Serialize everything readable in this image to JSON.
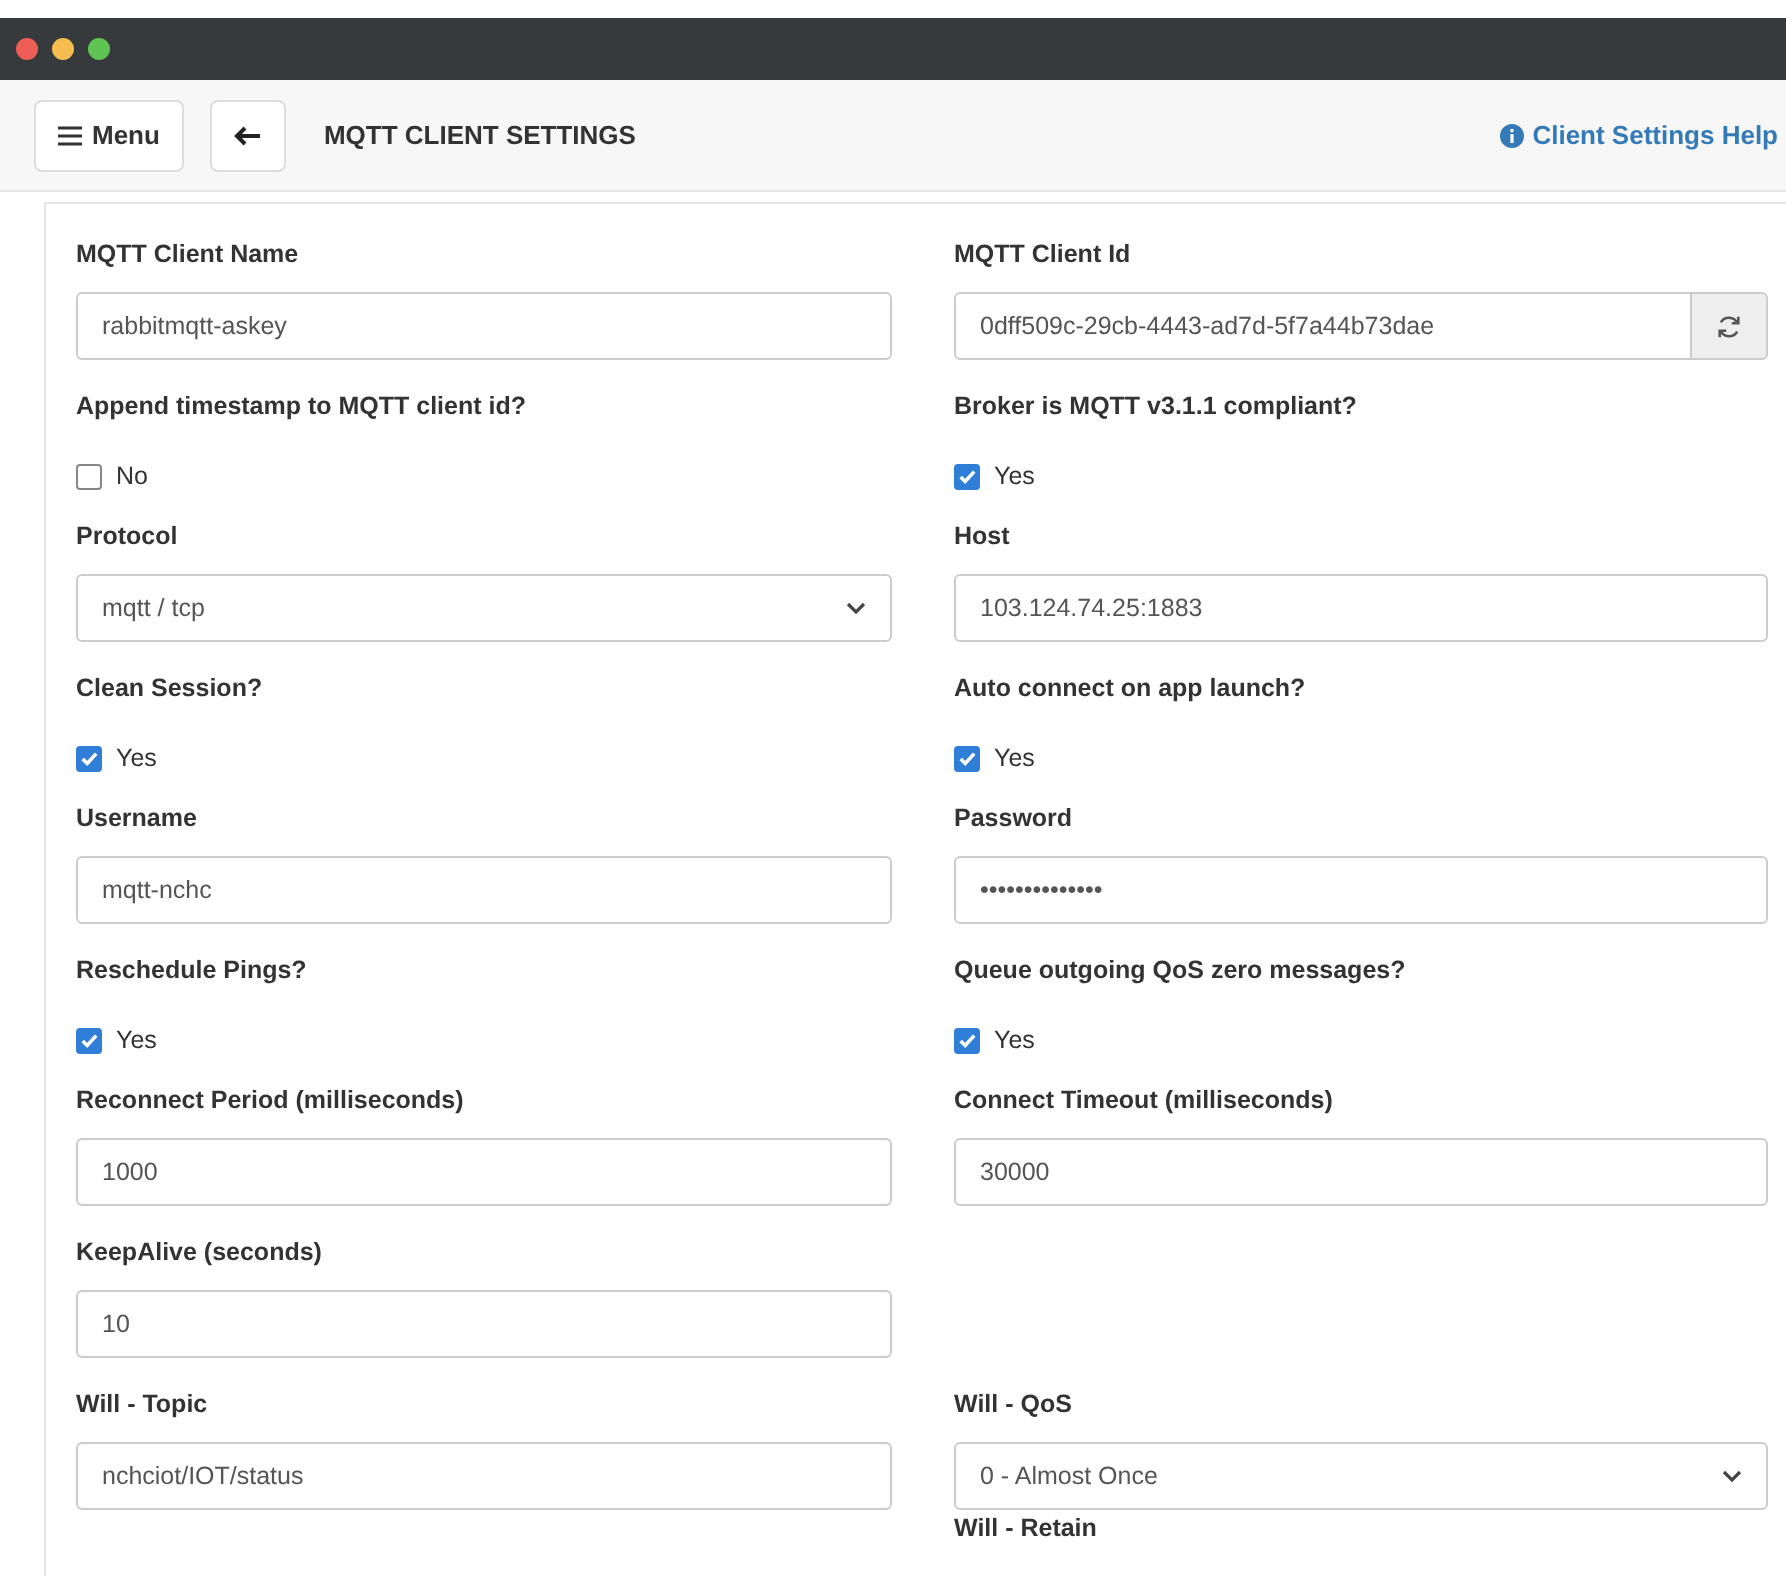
{
  "toolbar": {
    "menu_button": "Menu",
    "title": "MQTT CLIENT SETTINGS",
    "help_link": "Client Settings Help"
  },
  "rows": [
    [
      {
        "kind": "text",
        "label": "MQTT Client Name",
        "value": "rabbitmqtt-askey"
      },
      {
        "kind": "id",
        "label": "MQTT Client Id",
        "value": "0dff509c-29cb-4443-ad7d-5f7a44b73dae"
      }
    ],
    [
      {
        "kind": "checkbox",
        "label": "Append timestamp to MQTT client id?",
        "option": "No",
        "checked": false
      },
      {
        "kind": "checkbox",
        "label": "Broker is MQTT v3.1.1 compliant?",
        "option": "Yes",
        "checked": true
      }
    ],
    [
      {
        "kind": "select",
        "label": "Protocol",
        "value": "mqtt / tcp"
      },
      {
        "kind": "text",
        "label": "Host",
        "value": "103.124.74.25:1883"
      }
    ],
    [
      {
        "kind": "checkbox",
        "label": "Clean Session?",
        "option": "Yes",
        "checked": true
      },
      {
        "kind": "checkbox",
        "label": "Auto connect on app launch?",
        "option": "Yes",
        "checked": true
      }
    ],
    [
      {
        "kind": "text",
        "label": "Username",
        "value": "mqtt-nchc"
      },
      {
        "kind": "text",
        "label": "Password",
        "value": "••••••••••••••"
      }
    ],
    [
      {
        "kind": "checkbox",
        "label": "Reschedule Pings?",
        "option": "Yes",
        "checked": true
      },
      {
        "kind": "checkbox",
        "label": "Queue outgoing QoS zero messages?",
        "option": "Yes",
        "checked": true
      }
    ],
    [
      {
        "kind": "text",
        "label": "Reconnect Period (milliseconds)",
        "value": "1000"
      },
      {
        "kind": "text",
        "label": "Connect Timeout (milliseconds)",
        "value": "30000"
      }
    ],
    [
      {
        "kind": "text",
        "label": "KeepAlive (seconds)",
        "value": "10"
      },
      null
    ],
    [
      {
        "kind": "text",
        "label": "Will - Topic",
        "value": "nchciot/IOT/status"
      },
      {
        "kind": "select",
        "label": "Will - QoS",
        "value": "0 - Almost Once",
        "below": "Will - Retain"
      }
    ]
  ]
}
